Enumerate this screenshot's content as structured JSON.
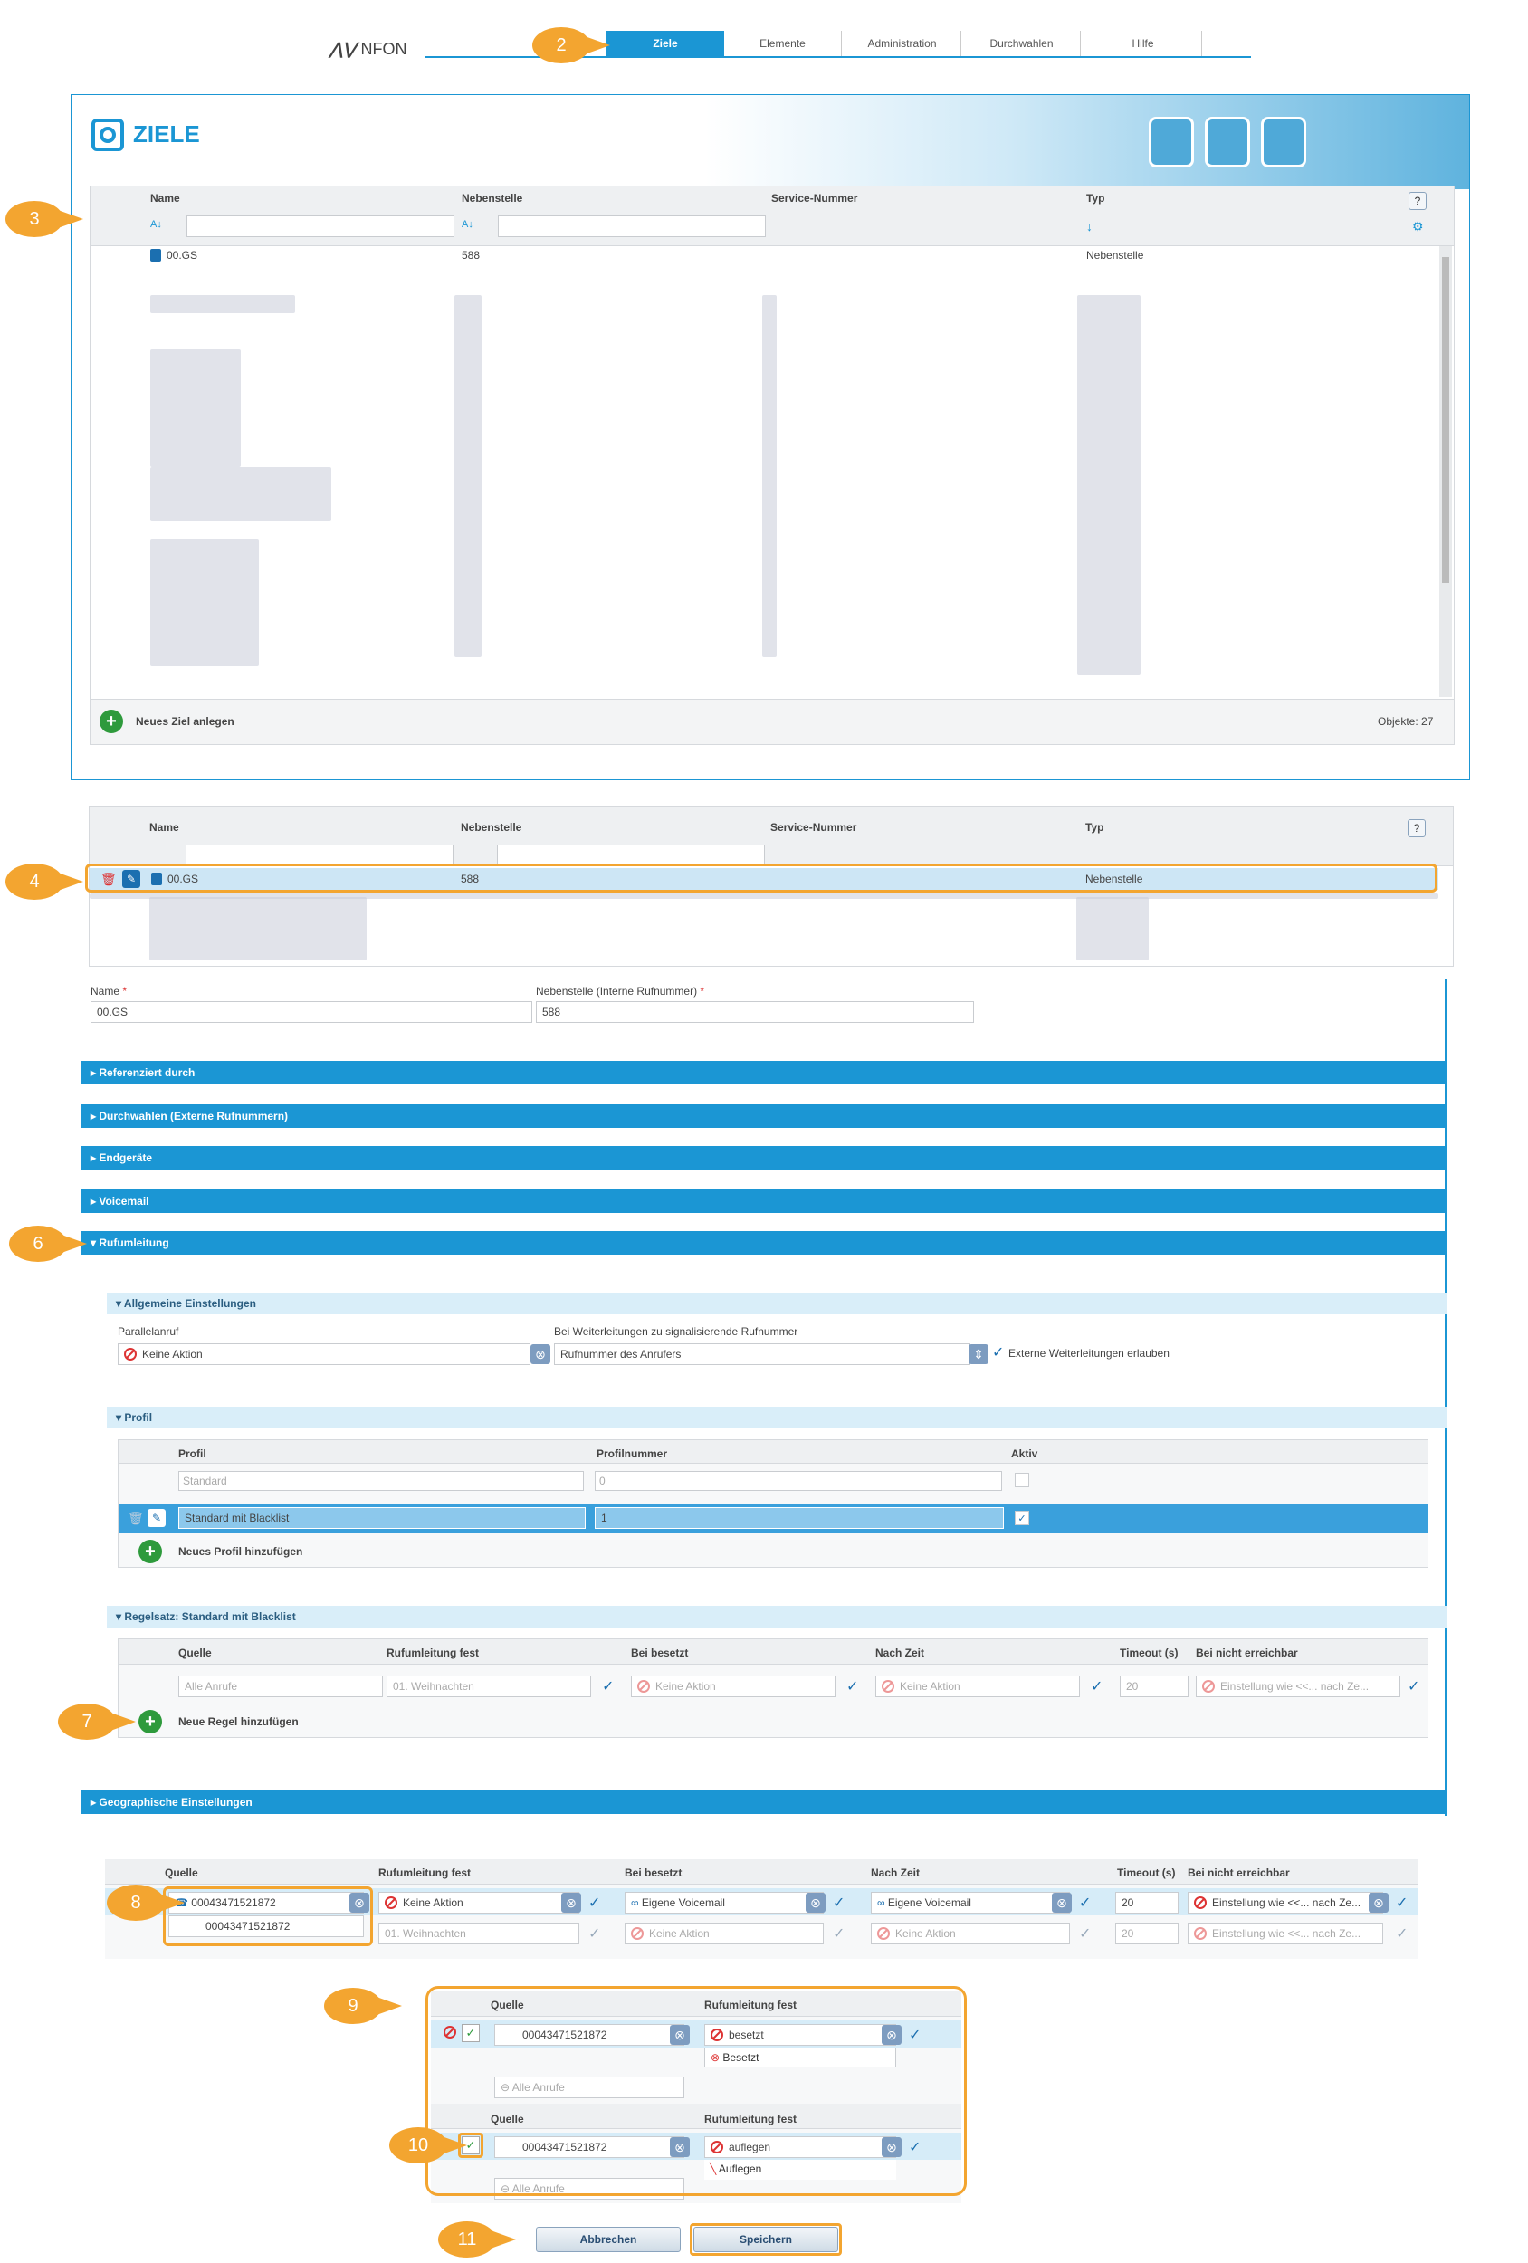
{
  "nav": {
    "logo": "NFON",
    "tabs": [
      "Ziele",
      "Elemente",
      "Administration",
      "Durchwahlen",
      "Hilfe"
    ]
  },
  "callouts": [
    "2",
    "3",
    "4",
    "6",
    "7",
    "8",
    "9",
    "10",
    "11"
  ],
  "ziele": {
    "title": "ZIELE",
    "columns": [
      "Name",
      "Nebenstelle",
      "Service-Nummer",
      "Typ"
    ],
    "help": "?",
    "first_row": {
      "name": "00.GS",
      "ext": "588",
      "type": "Nebenstelle"
    },
    "add_label": "Neues Ziel anlegen",
    "count": "Objekte: 27"
  },
  "form": {
    "name_label": "Name",
    "name_value": "00.GS",
    "ext_label": "Nebenstelle (Interne Rufnummer)",
    "ext_value": "588",
    "required": "*",
    "sections": [
      "Referenziert durch",
      "Durchwahlen (Externe Rufnummern)",
      "Endgeräte",
      "Voicemail",
      "Rufumleitung",
      "Geographische Einstellungen"
    ],
    "general": {
      "title": "Allgemeine Einstellungen",
      "parallel_label": "Parallelanruf",
      "parallel_value": "Keine Aktion",
      "signal_label": "Bei Weiterleitungen zu signalisierende Rufnummer",
      "signal_value": "Rufnummer des Anrufers",
      "external_label": "Externe Weiterleitungen erlauben"
    },
    "profile": {
      "title": "Profil",
      "columns": [
        "Profil",
        "Profilnummer",
        "Aktiv"
      ],
      "rows": [
        {
          "name": "Standard",
          "number": "0"
        },
        {
          "name": "Standard mit Blacklist",
          "number": "1"
        }
      ],
      "add_label": "Neues Profil hinzufügen"
    },
    "rules": {
      "title": "Regelsatz: Standard mit Blacklist",
      "columns": [
        "Quelle",
        "Rufumleitung fest",
        "Bei besetzt",
        "Nach Zeit",
        "Timeout (s)",
        "Bei nicht erreichbar"
      ],
      "row": {
        "source": "Alle Anrufe",
        "fixed": "01. Weihnachten",
        "busy": "Keine Aktion",
        "time": "Keine Aktion",
        "timeout": "20",
        "unreach": "Einstellung wie <<... nach Ze..."
      },
      "add_label": "Neue Regel hinzufügen"
    }
  },
  "edit_rule": {
    "source": "00043471521872",
    "suggestion": "00043471521872",
    "fixed": "Keine Aktion",
    "busy": "Eigene Voicemail",
    "time": "Eigene Voicemail",
    "timeout": "20",
    "unreach": "Einstellung wie <<... nach Ze...",
    "row2_fixed": "01. Weihnachten",
    "row2_busy": "Keine Aktion",
    "row2_time": "Keine Aktion",
    "row2_timeout": "20",
    "row2_unreach": "Einstellung wie <<... nach Ze..."
  },
  "step9": {
    "source": "00043471521872",
    "typed": "besetzt",
    "option": "Besetzt",
    "row2": "Alle Anrufe",
    "col_source": "Quelle",
    "col_fixed": "Rufumleitung fest"
  },
  "step10": {
    "source": "00043471521872",
    "typed": "auflegen",
    "option": "Auflegen",
    "row2": "Alle Anrufe",
    "col_source": "Quelle",
    "col_fixed": "Rufumleitung fest"
  },
  "buttons": {
    "cancel": "Abbrechen",
    "save": "Speichern"
  },
  "colors": {
    "accent": "#1b96d4",
    "callout": "#f3a530",
    "selection": "#3aa0dc"
  }
}
